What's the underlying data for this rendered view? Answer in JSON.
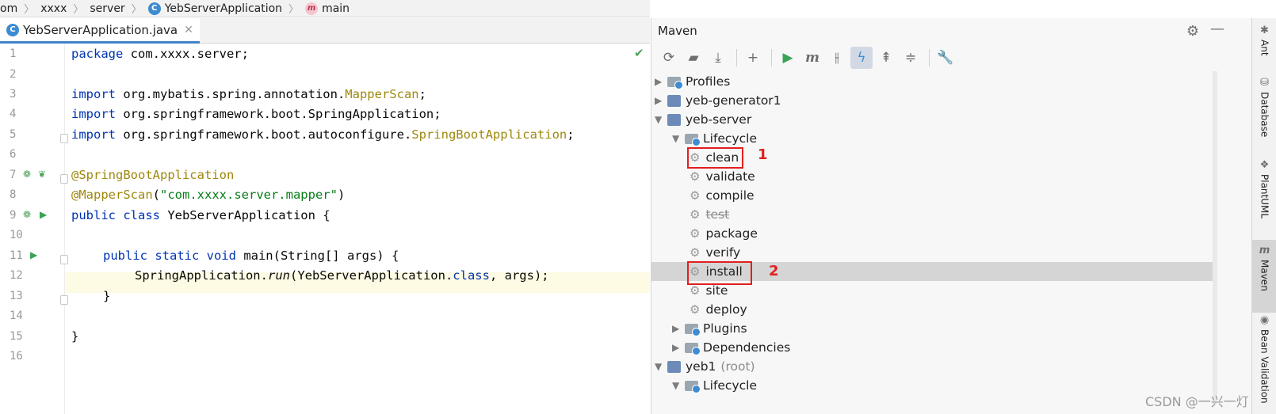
{
  "breadcrumb": {
    "items": [
      "om",
      "xxxx",
      "server",
      "YebServerApplication",
      "main"
    ]
  },
  "editor": {
    "tab_label": "YebServerApplication.java",
    "line_numbers": [
      "1",
      "2",
      "3",
      "4",
      "5",
      "6",
      "7",
      "8",
      "9",
      "10",
      "11",
      "12",
      "13",
      "14",
      "15",
      "16"
    ],
    "code": {
      "l1_kw": "package",
      "l1_rest": " com.xxxx.server;",
      "l3_kw": "import",
      "l3_rest": " org.mybatis.spring.annotation.",
      "l3_cls": "MapperScan",
      "l3_end": ";",
      "l4_kw": "import",
      "l4_rest": " org.springframework.boot.SpringApplication;",
      "l5_kw": "import",
      "l5_rest": " org.springframework.boot.autoconfigure.",
      "l5_cls": "SpringBootApplication",
      "l5_end": ";",
      "l7_ann": "@SpringBootApplication",
      "l8_ann": "@MapperScan",
      "l8_open": "(",
      "l8_str": "\"com.xxxx.server.mapper\"",
      "l8_close": ")",
      "l9_kw": "public class",
      "l9_rest": " YebServerApplication {",
      "l11_kw": "public static void",
      "l11_rest": " main(String[] args) {",
      "l12_a": "SpringApplication.",
      "l12_run": "run",
      "l12_b": "(YebServerApplication.",
      "l12_cls": "class",
      "l12_c": ", args);",
      "l13": "}",
      "l15": "}"
    }
  },
  "maven": {
    "title": "Maven",
    "toolbar_icons": [
      "reload-icon",
      "generate-sources-icon",
      "download-icon",
      "add-icon",
      "run-icon",
      "execute-goal-icon",
      "toggle-offline-icon",
      "skip-tests-icon",
      "show-dependencies-icon",
      "collapse-all-icon",
      "settings-wrench-icon"
    ],
    "tree": {
      "profiles": "Profiles",
      "generator": "yeb-generator1",
      "server": "yeb-server",
      "lifecycle": "Lifecycle",
      "phases": [
        "clean",
        "validate",
        "compile",
        "test",
        "package",
        "verify",
        "install",
        "site",
        "deploy"
      ],
      "plugins": "Plugins",
      "dependencies": "Dependencies",
      "root": "yeb1",
      "root_suffix": "(root)",
      "root_lifecycle": "Lifecycle"
    },
    "annotations": {
      "label1": "1",
      "label2": "2"
    },
    "selected_phase": "install"
  },
  "side_strip": [
    "Ant",
    "Database",
    "PlantUML",
    "Maven",
    "Bean Validation"
  ],
  "colors": {
    "annotation_red": "#e21f1f",
    "selection": "#d5d5d5",
    "accent_blue": "#4083c9"
  },
  "watermark": "CSDN @一兴一灯"
}
